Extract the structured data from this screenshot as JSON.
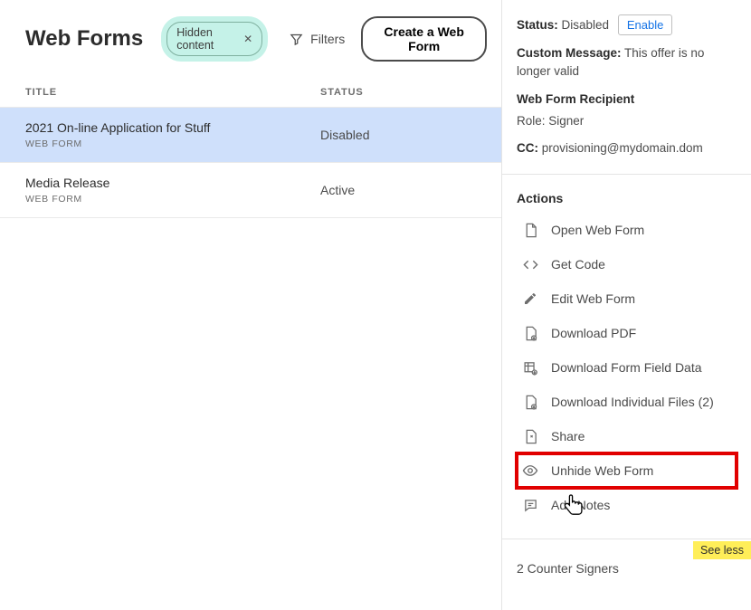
{
  "header": {
    "title": "Web Forms",
    "chip_label": "Hidden content",
    "filters_label": "Filters",
    "create_label": "Create a Web Form"
  },
  "columns": {
    "title": "TITLE",
    "status": "STATUS"
  },
  "rows": [
    {
      "name": "2021 On-line Application for Stuff",
      "type": "WEB FORM",
      "status": "Disabled",
      "selected": true
    },
    {
      "name": "Media Release",
      "type": "WEB FORM",
      "status": "Active",
      "selected": false
    }
  ],
  "details": {
    "status_label": "Status:",
    "status_value": "Disabled",
    "enable_label": "Enable",
    "custom_msg_label": "Custom Message:",
    "custom_msg_value": "This offer is no longer valid",
    "recipient_heading": "Web Form Recipient",
    "role_label": "Role:",
    "role_value": "Signer",
    "cc_label": "CC:",
    "cc_value": "provisioning@mydomain.dom"
  },
  "actions_heading": "Actions",
  "actions": {
    "open": "Open Web Form",
    "get_code": "Get Code",
    "edit": "Edit Web Form",
    "download_pdf": "Download PDF",
    "download_fields": "Download Form Field Data",
    "download_files": "Download Individual Files (2)",
    "share": "Share",
    "unhide": "Unhide Web Form",
    "add_notes": "Add Notes"
  },
  "see_less_label": "See less",
  "counter_signers": "2 Counter Signers"
}
